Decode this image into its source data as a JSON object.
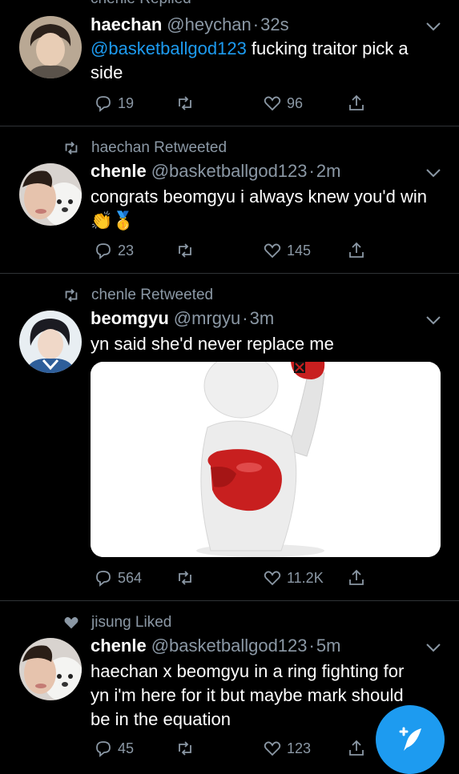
{
  "top_context": "chenle Replied",
  "tweets": [
    {
      "name": "haechan",
      "handle": "@heychan",
      "time": "32s",
      "mention": "@basketballgod123",
      "text": " fucking traitor pick a side",
      "replies": "19",
      "retweets": "",
      "likes": "96"
    },
    {
      "context": "haechan Retweeted",
      "name": "chenle",
      "handle": "@basketballgod123",
      "time": "2m",
      "text": "congrats beomgyu i always knew you'd win 👏🥇",
      "replies": "23",
      "retweets": "",
      "likes": "145"
    },
    {
      "context": "chenle Retweeted",
      "name": "beomgyu",
      "handle": "@mrgyu",
      "time": "3m",
      "text": "yn said she'd never replace me",
      "replies": "564",
      "retweets": "",
      "likes": "11.2K"
    },
    {
      "context": "jisung Liked",
      "name": "chenle",
      "handle": "@basketballgod123",
      "time": "5m",
      "text": "haechan x beomgyu in a ring fighting for yn i'm here for it but maybe mark should be in the equation",
      "replies": "45",
      "retweets": "",
      "likes": "123"
    }
  ],
  "icons": {
    "reply": "reply-icon",
    "retweet": "retweet-icon",
    "like": "heart-icon",
    "share": "share-icon",
    "compose": "compose-tweet-icon"
  },
  "colors": {
    "accent": "#1d9bf0",
    "muted": "#8b98a5",
    "background": "#000000"
  }
}
